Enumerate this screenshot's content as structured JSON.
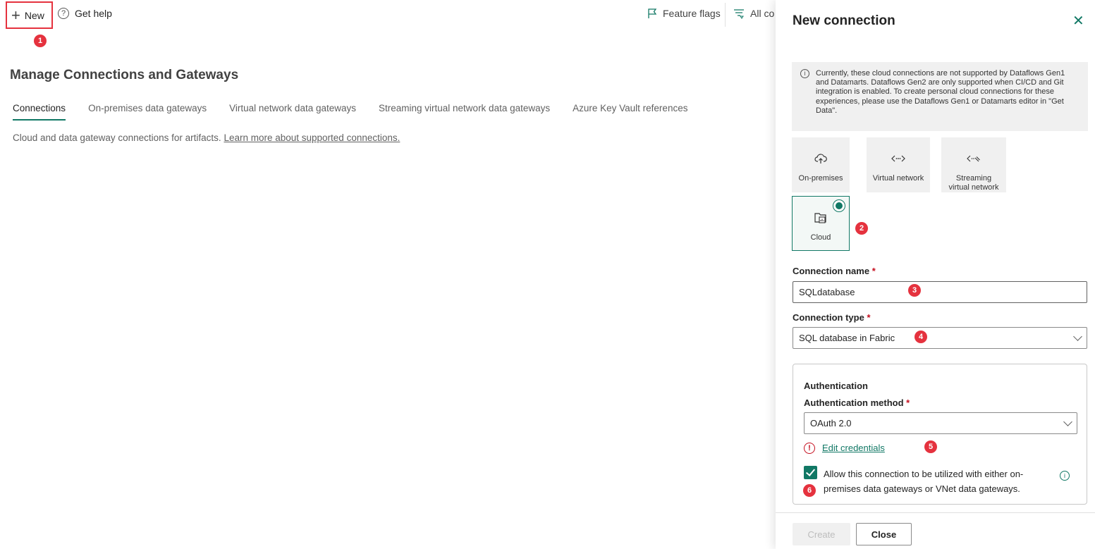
{
  "toolbar": {
    "new_label": "New",
    "help_label": "Get help",
    "flags_label": "Feature flags",
    "filter_label": "All co"
  },
  "markers": [
    "1",
    "2",
    "3",
    "4",
    "5",
    "6"
  ],
  "page": {
    "title": "Manage Connections and Gateways",
    "tabs": [
      {
        "label": "Connections",
        "active": true
      },
      {
        "label": "On-premises data gateways",
        "active": false
      },
      {
        "label": "Virtual network data gateways",
        "active": false
      },
      {
        "label": "Streaming virtual network data gateways",
        "active": false
      },
      {
        "label": "Azure Key Vault references",
        "active": false
      }
    ],
    "description": "Cloud and data gateway connections for artifacts.",
    "description_link": "Learn more about supported connections."
  },
  "panel": {
    "title": "New connection",
    "close_glyph": "✕",
    "info_text": "Currently, these cloud connections are not supported by Dataflows Gen1 and Datamarts. Dataflows Gen2 are only supported when CI/CD and Git integration is enabled. To create personal cloud connections for these experiences, please use the Dataflows Gen1 or Datamarts editor in \"Get Data\".",
    "tiles": [
      {
        "label": "On-premises",
        "icon": "cloud-upload-icon",
        "selected": false
      },
      {
        "label": "Virtual network",
        "icon": "virtual-network-icon",
        "selected": false
      },
      {
        "label": "Streaming virtual network",
        "icon": "streaming-network-icon",
        "selected": false
      },
      {
        "label": "Cloud",
        "icon": "cloud-datasource-icon",
        "selected": true
      }
    ],
    "connection_name_label": "Connection name",
    "connection_name_value": "SQLdatabase",
    "connection_type_label": "Connection type",
    "connection_type_value": "SQL database in Fabric",
    "required_mark": "*",
    "auth": {
      "heading": "Authentication",
      "method_label": "Authentication method",
      "method_value": "OAuth 2.0",
      "edit_link": "Edit credentials",
      "checkbox_checked": true,
      "checkbox_text": "Allow this connection to be utilized with either on-premises data gateways or VNet data gateways."
    },
    "create_label": "Create",
    "close_label": "Close"
  },
  "colors": {
    "accent": "#117865",
    "marker": "#e5323e",
    "required": "#c50f1f"
  }
}
